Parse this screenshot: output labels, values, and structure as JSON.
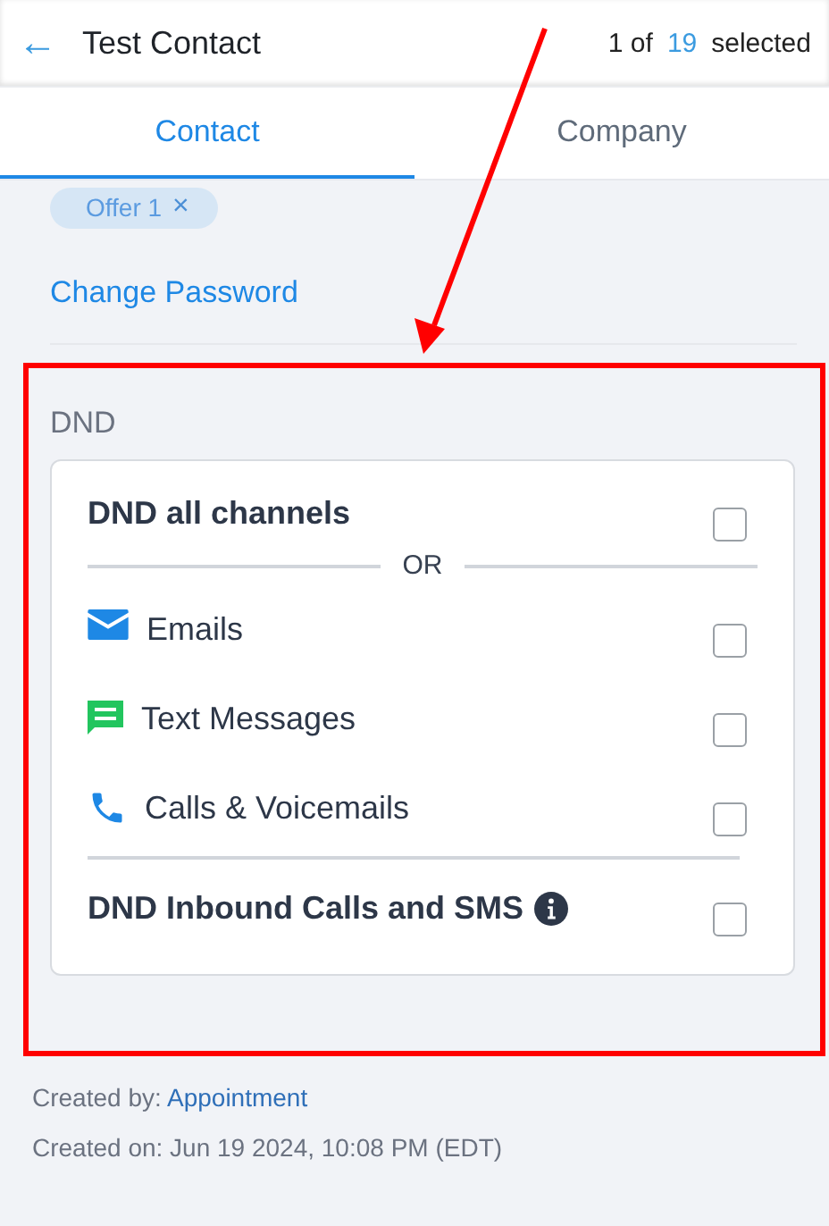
{
  "header": {
    "back": "←",
    "title": "Test Contact",
    "counter": {
      "prefix": "1 of",
      "count": "19",
      "suffix": "selected"
    }
  },
  "tabs": [
    {
      "label": "Contact",
      "selected": true
    },
    {
      "label": "Company",
      "selected": false
    }
  ],
  "tag": {
    "label": "Offer 1",
    "remove": "×"
  },
  "change_password": "Change Password",
  "dnd": {
    "heading": "DND",
    "separator": "OR",
    "options": [
      {
        "kind": "all",
        "label": "DND all channels",
        "checked": false
      },
      {
        "kind": "email",
        "label": "Emails",
        "checked": false
      },
      {
        "kind": "sms",
        "label": "Text Messages",
        "checked": false
      },
      {
        "kind": "call",
        "label": "Calls & Voicemails",
        "checked": false
      },
      {
        "kind": "inbound",
        "label": "DND Inbound Calls and SMS",
        "checked": false
      }
    ]
  },
  "footer": {
    "created_by_label": "Created by:",
    "created_by": "Appointment",
    "created_on": "Created on: Jun 19 2024, 10:08 PM (EDT)"
  }
}
